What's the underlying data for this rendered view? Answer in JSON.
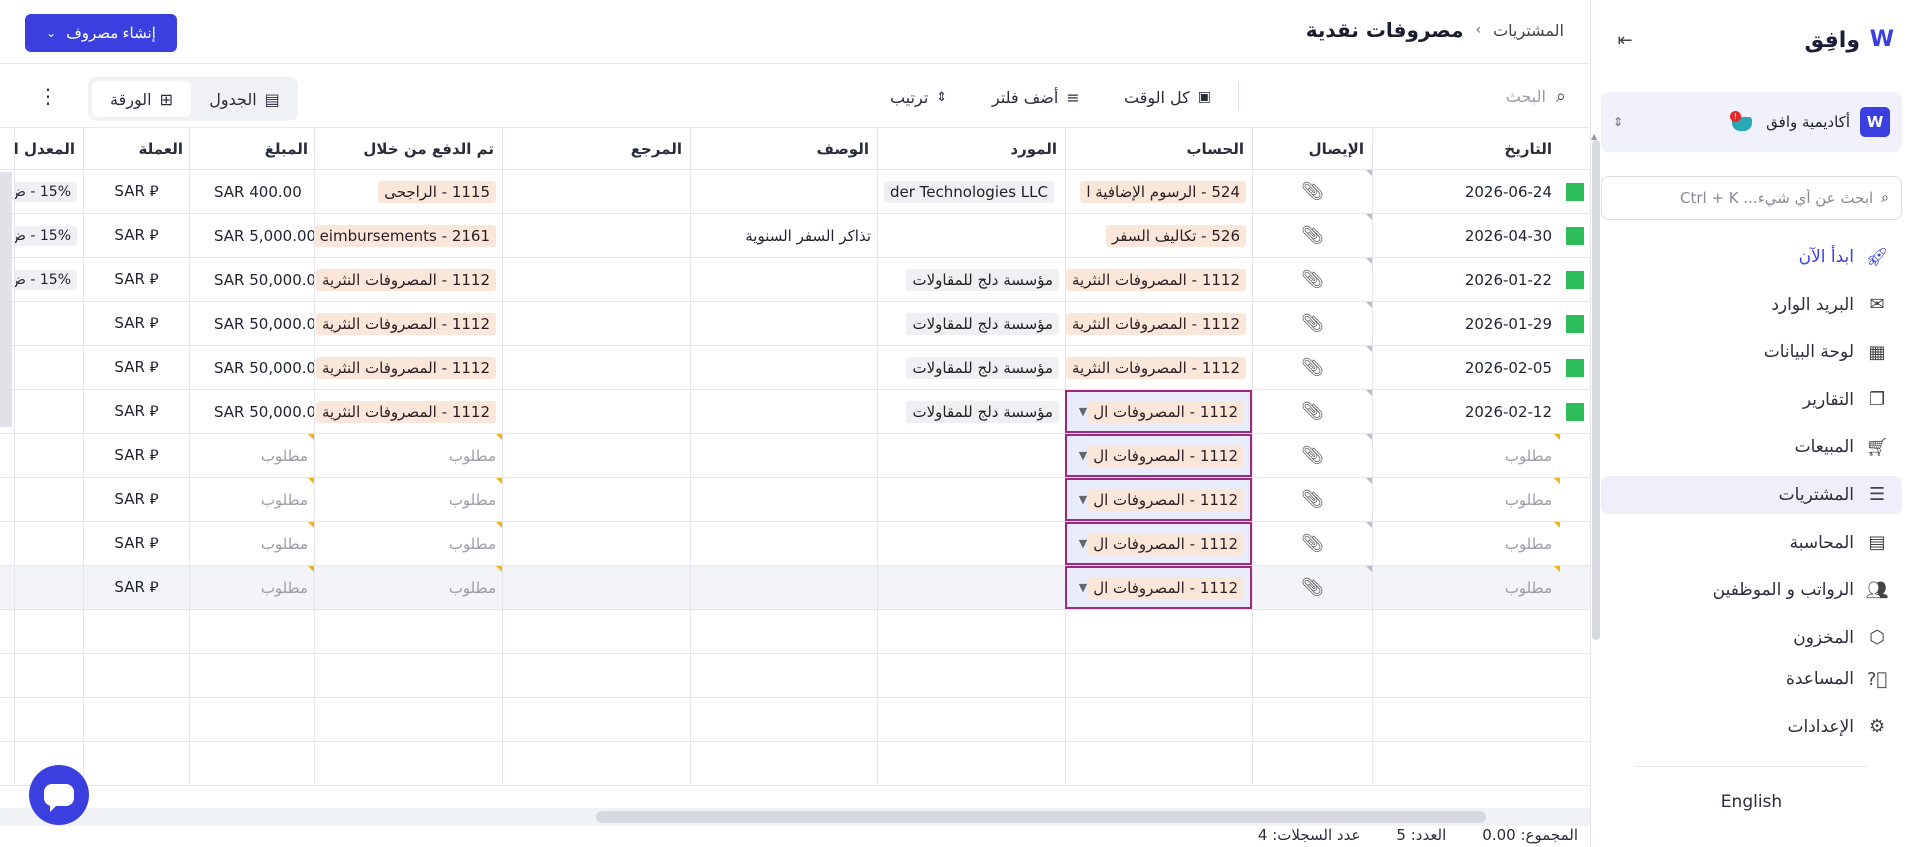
{
  "sidebar": {
    "logo_text": "وافِق",
    "org_name": "أكاديمية وافق",
    "org_badge": "W",
    "search_placeholder": "ابحث عن أي شيء... Ctrl + K",
    "nav": [
      {
        "label": "ابدأ الآن",
        "icon": "rocket-icon"
      },
      {
        "label": "البريد الوارد",
        "icon": "mail-icon"
      },
      {
        "label": "لوحة البيانات",
        "icon": "dashboard-icon"
      },
      {
        "label": "التقارير",
        "icon": "reports-icon"
      },
      {
        "label": "المبيعات",
        "icon": "cart-icon"
      },
      {
        "label": "المشتريات",
        "icon": "receipt-icon"
      },
      {
        "label": "المحاسبة",
        "icon": "ledger-icon"
      },
      {
        "label": "الرواتب و الموظفين",
        "icon": "people-icon"
      },
      {
        "label": "المخزون",
        "icon": "box-icon"
      },
      {
        "label": "المساعدة",
        "icon": "help-icon"
      },
      {
        "label": "الإعدادات",
        "icon": "gear-icon"
      }
    ],
    "language": "English"
  },
  "header": {
    "breadcrumb_parent": "المشتريات",
    "breadcrumb_sep": "›",
    "title": "مصروفات نقدية",
    "create_button": "إنشاء مصروف"
  },
  "toolbar": {
    "search_placeholder": "البحث",
    "time_filter": "كل الوقت",
    "add_filter": "أضف فلتر",
    "sort": "ترتيب",
    "view_table": "الجدول",
    "view_sheet": "الورقة"
  },
  "columns": {
    "date": "التاريخ",
    "receipt": "الإيصال",
    "account": "الحساب",
    "vendor": "المورد",
    "description": "الوصف",
    "reference": "المرجع",
    "paid_through": "تم الدفع من خلال",
    "amount": "المبلغ",
    "currency": "العملة",
    "tax_rate": "المعدل الض"
  },
  "rows": [
    {
      "date": "2026-06-24",
      "account": "524 - الرسوم الإضافية ا",
      "vendor": "der Technologies LLC",
      "description": "",
      "reference": "",
      "paid": "1115 - الراجحى",
      "amount": "SAR 400.00",
      "currency": "SAR ⃁",
      "tax": "15% - ض"
    },
    {
      "date": "2026-04-30",
      "account": "526 - تكاليف السفر",
      "vendor": "",
      "description": "تذاكر السفر السنوية",
      "reference": "",
      "paid": "eimbursements - 2161",
      "amount": "SAR 5,000.00",
      "currency": "SAR ⃁",
      "tax": "15% - ض"
    },
    {
      "date": "2026-01-22",
      "account": "1112 - المصروفات النثرية",
      "vendor": "مؤسسة دلج للمقاولات",
      "description": "",
      "reference": "",
      "paid": "1112 - المصروفات النثرية",
      "amount": "SAR 50,000.00",
      "currency": "SAR ⃁",
      "tax": "15% - ض"
    },
    {
      "date": "2026-01-29",
      "account": "1112 - المصروفات النثرية",
      "vendor": "مؤسسة دلج للمقاولات",
      "description": "",
      "reference": "",
      "paid": "1112 - المصروفات النثرية",
      "amount": "SAR 50,000.00",
      "currency": "SAR ⃁",
      "tax": ""
    },
    {
      "date": "2026-02-05",
      "account": "1112 - المصروفات النثرية",
      "vendor": "مؤسسة دلج للمقاولات",
      "description": "",
      "reference": "",
      "paid": "1112 - المصروفات النثرية",
      "amount": "SAR 50,000.00",
      "currency": "SAR ⃁",
      "tax": ""
    },
    {
      "date": "2026-02-12",
      "account": "1112 - المصروفات ال",
      "vendor": "مؤسسة دلج للمقاولات",
      "description": "",
      "reference": "",
      "paid": "1112 - المصروفات النثرية",
      "amount": "SAR 50,000.00",
      "currency": "SAR ⃁",
      "tax": ""
    }
  ],
  "new_rows": {
    "required": "مطلوب",
    "account": "1112 - المصروفات ال",
    "currency": "SAR ⃁"
  },
  "footer": {
    "total": "المجموع: 0.00",
    "count": "العدد: 5",
    "records": "عدد السجلات: 4"
  }
}
